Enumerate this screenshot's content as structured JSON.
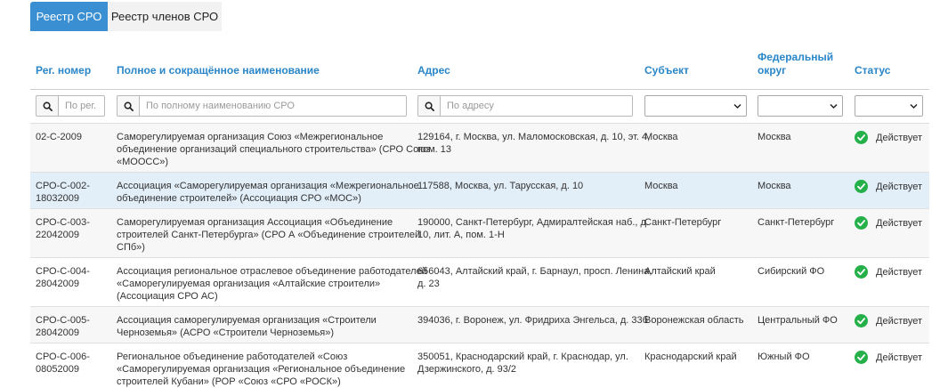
{
  "tabs": [
    {
      "label": "Реестр СРО",
      "active": true
    },
    {
      "label": "Реестр членов СРО",
      "active": false
    }
  ],
  "columns": {
    "reg": "Рег. номер",
    "name": "Полное и сокращённое наименование",
    "address": "Адрес",
    "subject": "Субъект",
    "district_line1": "Федеральный",
    "district_line2": "округ",
    "status": "Статус"
  },
  "filters": {
    "reg_placeholder": "По рег. номеру",
    "name_placeholder": "По полному наименованию СРО",
    "address_placeholder": "По адресу"
  },
  "colors": {
    "accent": "#3a8fd2",
    "header_text": "#2a86c8",
    "status_ok": "#25b04a"
  },
  "rows": [
    {
      "reg": [
        "02-С-2009"
      ],
      "name": [
        "Саморегулируемая организация Союз «Межрегиональное",
        "объединение организаций специального строительства» (СРО Союз",
        "«МООСС»)"
      ],
      "address": [
        "129164, г. Москва, ул. Маломосковская, д. 10, эт. 4,",
        "пом. 13"
      ],
      "subject": "Москва",
      "district": "Москва",
      "status": "Действует"
    },
    {
      "reg": [
        "СРО-С-002-",
        "18032009"
      ],
      "name": [
        "Ассоциация «Саморегулируемая организация «Межрегиональное",
        "объединение строителей» (Ассоциация СРО «МОС»)"
      ],
      "address": [
        "117588, Москва, ул. Тарусская, д. 10"
      ],
      "subject": "Москва",
      "district": "Москва",
      "status": "Действует"
    },
    {
      "reg": [
        "СРО-С-003-",
        "22042009"
      ],
      "name": [
        "Саморегулируемая организация Ассоциация «Объединение",
        "строителей Санкт-Петербурга» (СРО А «Объединение строителей",
        "СПб»)"
      ],
      "address": [
        "190000, Санкт-Петербург, Адмиралтейская наб., д.",
        "10, лит. А, пом. 1-Н"
      ],
      "subject": "Санкт-Петербург",
      "district": "Санкт-Петербург",
      "status": "Действует"
    },
    {
      "reg": [
        "СРО-С-004-",
        "28042009"
      ],
      "name": [
        "Ассоциация региональное отраслевое объединение работодателей",
        "«Саморегулируемая организация «Алтайские строители»",
        "(Ассоциация СРО АС)"
      ],
      "address": [
        "656043, Алтайский край, г. Барнаул, просп. Ленина,",
        "д. 23"
      ],
      "subject": "Алтайский край",
      "district": "Сибирский ФО",
      "status": "Действует"
    },
    {
      "reg": [
        "СРО-С-005-",
        "28042009"
      ],
      "name": [
        "Ассоциация саморегулируемая организация «Строители",
        "Черноземья» (АСРО «Строители Черноземья»)"
      ],
      "address": [
        "394036, г. Воронеж, ул. Фридриха Энгельса, д. 33б"
      ],
      "subject": "Воронежская область",
      "district": "Центральный ФО",
      "status": "Действует"
    },
    {
      "reg": [
        "СРО-С-006-",
        "08052009"
      ],
      "name": [
        "Региональное объединение работодателей «Союз",
        "«Саморегулируемая организация «Региональное объединение",
        "строителей Кубани» (РОР «Союз «СРО «РОСК»)"
      ],
      "address": [
        "350051, Краснодарский край, г. Краснодар, ул.",
        "Дзержинского, д. 93/2"
      ],
      "subject": "Краснодарский край",
      "district": "Южный ФО",
      "status": "Действует"
    }
  ]
}
